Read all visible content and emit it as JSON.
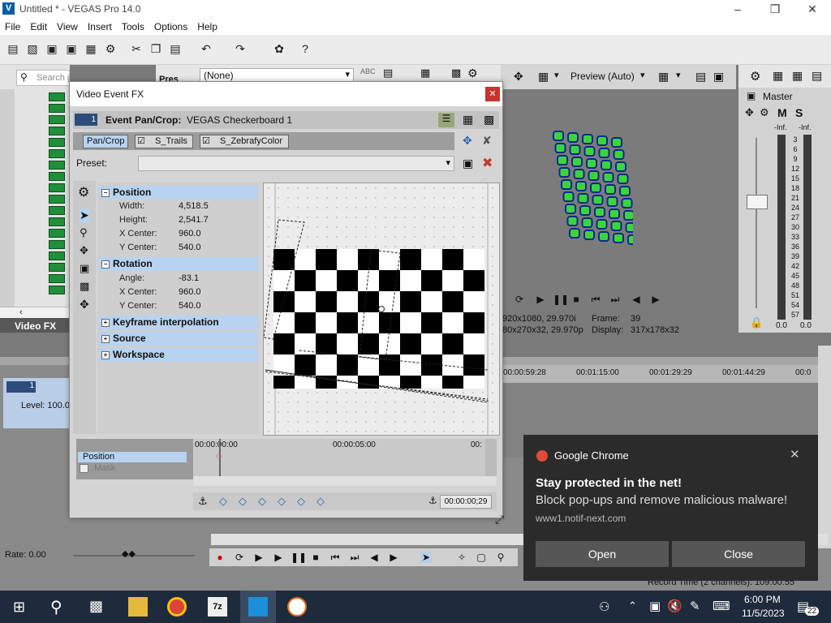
{
  "window": {
    "title": "Untitled * - VEGAS Pro 14.0"
  },
  "menu": [
    "File",
    "Edit",
    "View",
    "Insert",
    "Tools",
    "Options",
    "Help"
  ],
  "explorer": {
    "search_placeholder": "Search plug-ins",
    "tab_label": "Video FX",
    "col_label": "Pres"
  },
  "preset_dropdown": {
    "value": "(None)"
  },
  "preview": {
    "mode": "Preview (Auto)",
    "info_left_1": "920x1080, 29.970i",
    "info_left_2": "80x270x32, 29.970p",
    "frame_label": "Frame:",
    "frame_value": "39",
    "display_label": "Display:",
    "display_value": "317x178x32"
  },
  "master": {
    "title": "Master",
    "m_label": "M",
    "s_label": "S",
    "inf_left": "-Inf.",
    "inf_right": "-Inf.",
    "scale": [
      "3",
      "6",
      "9",
      "12",
      "15",
      "18",
      "21",
      "24",
      "27",
      "30",
      "33",
      "36",
      "39",
      "42",
      "45",
      "48",
      "51",
      "54",
      "57"
    ],
    "readout_left": "0.0",
    "readout_right": "0.0"
  },
  "timeline": {
    "ruler": [
      "00:00:59:28",
      "00:01:15:00",
      "00:01:29:29",
      "00:01:44:29",
      "00:0"
    ],
    "track_number": "1",
    "level": "Level: 100.0",
    "rate": "Rate: 0.00",
    "record_time": "Record Time (2 channels): 109:00:55"
  },
  "dialog": {
    "title": "Video Event FX",
    "chain_index": "1",
    "event_label": "Event Pan/Crop:",
    "event_name": "VEGAS Checkerboard 1",
    "chain": [
      "Pan/Crop",
      "S_Trails",
      "S_ZebrafyColor"
    ],
    "preset_label": "Preset:",
    "sections": {
      "position": {
        "title": "Position",
        "rows": [
          {
            "label": "Width:",
            "value": "4,518.5"
          },
          {
            "label": "Height:",
            "value": "2,541.7"
          },
          {
            "label": "X Center:",
            "value": "960.0"
          },
          {
            "label": "Y Center:",
            "value": "540.0"
          }
        ]
      },
      "rotation": {
        "title": "Rotation",
        "rows": [
          {
            "label": "Angle:",
            "value": "-83.1"
          },
          {
            "label": "X Center:",
            "value": "960.0"
          },
          {
            "label": "Y Center:",
            "value": "540.0"
          }
        ]
      },
      "keyframe": "Keyframe interpolation",
      "source": "Source",
      "workspace": "Workspace"
    },
    "keyframe_tracks": [
      "Position",
      "Mask"
    ],
    "kf_ruler_start": "00:00:00:00",
    "kf_ruler_mid": "00:00:05:00",
    "kf_ruler_end": "00:",
    "kf_time": "00:00:00;29"
  },
  "toast": {
    "app": "Google Chrome",
    "headline": "Stay protected in the net!",
    "body": "Block pop-ups and remove malicious malware!",
    "url": "www1.notif-next.com",
    "open_label": "Open",
    "close_label": "Close"
  },
  "taskbar": {
    "time": "6:00 PM",
    "date": "11/5/2023",
    "notif_count": "22"
  }
}
